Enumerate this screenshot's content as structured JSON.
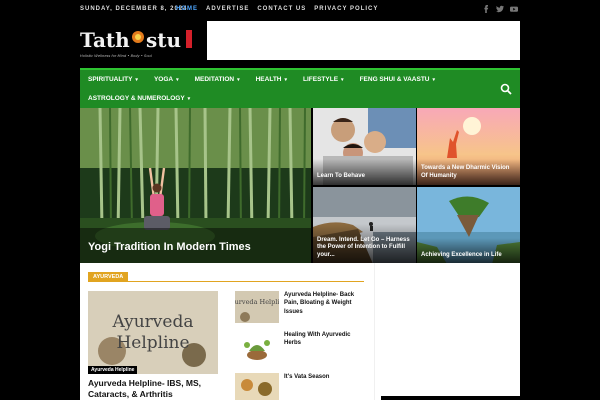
{
  "topbar": {
    "date": "SUNDAY, DECEMBER 8, 2024",
    "menu": [
      "HOME",
      "ADVERTISE",
      "CONTACT US",
      "PRIVACY POLICY"
    ],
    "active_index": 0
  },
  "social_icons": [
    "facebook-icon",
    "twitter-icon",
    "youtube-icon"
  ],
  "logo": {
    "text": "Tathaastu",
    "tagline": "Holistic Wellness for Mind • Body • Soul"
  },
  "nav": {
    "items": [
      {
        "label": "SPIRITUALITY"
      },
      {
        "label": "YOGA"
      },
      {
        "label": "MEDITATION"
      },
      {
        "label": "HEALTH"
      },
      {
        "label": "LIFESTYLE"
      },
      {
        "label": "FENG SHUI & VAASTU"
      },
      {
        "label": "ASTROLOGY & NUMEROLOGY"
      }
    ],
    "search_icon": "search-icon"
  },
  "featured": {
    "big": {
      "title": "Yogi Tradition In Modern Times"
    },
    "tiles": [
      {
        "title": "Learn To Behave"
      },
      {
        "title": "Towards a New Dharmic Vision Of Humanity"
      },
      {
        "title": "Dream. Intend. Let Go – Harness the Power of Intention to Fulfill your..."
      },
      {
        "title": "Achieving Excellence in Life"
      }
    ]
  },
  "section": {
    "category": "AYURVEDA",
    "main": {
      "thumb_label": "Ayurveda Helpline",
      "thumb_art_lines": [
        "Ayurveda",
        "Helpline"
      ],
      "title": "Ayurveda Helpline- IBS, MS, Cataracts, & Arthritis"
    },
    "side": [
      {
        "title": "Ayurveda Helpline- Back Pain, Bloating & Weight Issues",
        "thumb_text": "Ayurveda Helpline"
      },
      {
        "title": "Healing With Ayurvedic Herbs"
      },
      {
        "title": "It's Vata Season"
      }
    ]
  },
  "colors": {
    "nav_green": "#1f8b24",
    "accent_blue": "#4da6ff",
    "category_orange": "#e1a420"
  }
}
